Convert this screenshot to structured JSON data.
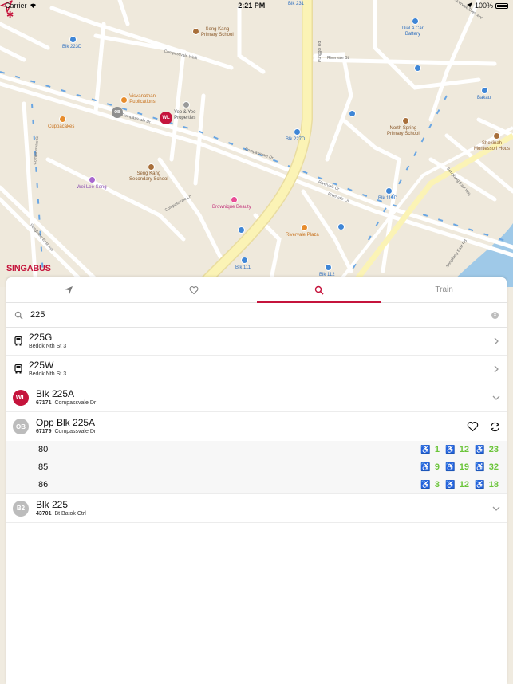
{
  "status": {
    "carrier": "Carrier",
    "time": "2:21 PM",
    "battery": "100%"
  },
  "map": {
    "brand": "SINGABUS",
    "labels": {
      "seng_kang_primary": "Seng Kang\nPrimary School",
      "blk_223d": "Blk 223D",
      "visvanathan": "Visvanathan\nPublications",
      "yeo_yeo": "Yeo & Yeo\nProperties",
      "cuppacakes": "Cuppacakes",
      "seng_kang_secondary": "Seng Kang\nSecondary School",
      "wei_lee_seng": "Wei Lee Seng",
      "brownique": "Brownique Beauty",
      "rivervale_plaza": "Rivervale Plaza",
      "blk_231": "Blk 231",
      "blk_227d": "Blk 227D",
      "blk_111": "Blk 111",
      "blk_112": "Blk 112",
      "blk_119d": "Blk 119D",
      "dial_a_car": "Dial A Car\nBattery",
      "bakau": "Bakau",
      "north_spring": "North Spring\nPrimary School",
      "shekinah": "Shekinah\nMontessori Hous",
      "punggol_rd": "Punggol Rd",
      "compassvale_walk": "Compassvale Walk",
      "compassvale_dr": "Compassvale Dr",
      "compassvale_dr_2": "Compassvale Dr",
      "compassvale_ln": "Compassvale Ln",
      "compassvale_st": "Compassvale St",
      "rivervale_st": "Rivervale St",
      "rivervale_dr": "Rivervale Dr",
      "rivervale_ln": "Rivervale Ln",
      "sengkang_east_ave": "Sengkang East Ave",
      "sengkang_east_way": "Sengkang East Way",
      "sengkang_east_rd": "Sengkang East Rd",
      "rivervale_cres": "Rivervale Crescent",
      "marker_wl": "WL",
      "marker_ob": "OB"
    }
  },
  "tabs": [
    {
      "name": "nearby",
      "label": "",
      "icon": "location-arrow-icon"
    },
    {
      "name": "favorites",
      "label": "",
      "icon": "heart-icon"
    },
    {
      "name": "search",
      "label": "",
      "icon": "search-icon",
      "active": true
    },
    {
      "name": "train",
      "label": "Train",
      "icon": ""
    }
  ],
  "search": {
    "value": "225",
    "placeholder": ""
  },
  "results": {
    "services": [
      {
        "number": "225G",
        "route": "Bedok Nth St 3"
      },
      {
        "number": "225W",
        "route": "Bedok Nth St 3"
      }
    ],
    "stops": [
      {
        "badge": "WL",
        "name": "Blk 225A",
        "code": "67171",
        "road": "Compassvale Dr"
      },
      {
        "badge": "OB",
        "name": "Opp Blk 225A",
        "code": "67179",
        "road": "Compassvale Dr"
      },
      {
        "badge": "B2",
        "name": "Blk 225",
        "code": "43701",
        "road": "Bt Batok Ctrl"
      }
    ],
    "arrivals": [
      {
        "service": "80",
        "times": [
          "1",
          "12",
          "23"
        ]
      },
      {
        "service": "85",
        "times": [
          "9",
          "19",
          "32"
        ]
      },
      {
        "service": "86",
        "times": [
          "3",
          "12",
          "18"
        ]
      }
    ]
  },
  "colors": {
    "accent": "#c5143c",
    "arrival": "#6bc53a",
    "road_major": "#fbf3b5",
    "water": "#9fc9e8"
  }
}
